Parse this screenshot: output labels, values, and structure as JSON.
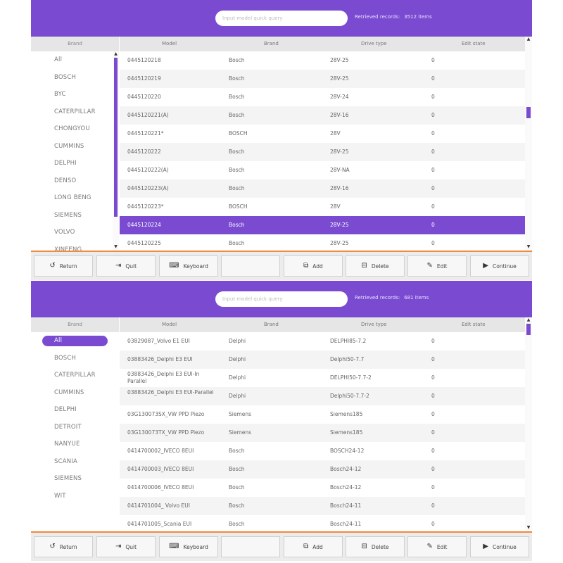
{
  "panels": [
    {
      "search": {
        "placeholder": "Input model quick query"
      },
      "records": {
        "label": "Retrieved records:",
        "value": "3512 items"
      },
      "brand": {
        "header": "Brand",
        "items": [
          "All",
          "BOSCH",
          "BYC",
          "CATERPILLAR",
          "CHONGYOU",
          "CUMMINS",
          "DELPHI",
          "DENSO",
          "LONG BENG",
          "SIEMENS",
          "VOLVO",
          "XINFENG"
        ],
        "selected_index": null,
        "scroll": {
          "up_arrow": "▲",
          "down_arrow": "▼"
        }
      },
      "table": {
        "columns": [
          "Model",
          "Brand",
          "Drive type",
          "Edit state"
        ],
        "rows": [
          [
            "0445120218",
            "Bosch",
            "28V-25",
            "0"
          ],
          [
            "0445120219",
            "Bosch",
            "28V-25",
            "0"
          ],
          [
            "0445120220",
            "Bosch",
            "28V-24",
            "0"
          ],
          [
            "0445120221(A)",
            "Bosch",
            "28V-16",
            "0"
          ],
          [
            "0445120221*",
            "BOSCH",
            "28V",
            "0"
          ],
          [
            "0445120222",
            "Bosch",
            "28V-25",
            "0"
          ],
          [
            "0445120222(A)",
            "Bosch",
            "28V-NA",
            "0"
          ],
          [
            "0445120223(A)",
            "Bosch",
            "28V-16",
            "0"
          ],
          [
            "0445120223*",
            "BOSCH",
            "28V",
            "0"
          ],
          [
            "0445120224",
            "Bosch",
            "28V-25",
            "0"
          ],
          [
            "0445120225",
            "Bosch",
            "28V-25",
            "0"
          ]
        ],
        "selected_row": 9,
        "scroll": {
          "up_arrow": "▲",
          "down_arrow": "▼"
        }
      }
    },
    {
      "search": {
        "placeholder": "Input model quick query"
      },
      "records": {
        "label": "Retrieved records:",
        "value": "681 items"
      },
      "brand": {
        "header": "Brand",
        "items": [
          "All",
          "BOSCH",
          "CATERPILLAR",
          "CUMMINS",
          "DELPHI",
          "DETROIT",
          "NANYUE",
          "SCANIA",
          "SIEMENS",
          "WIT"
        ],
        "selected_index": 0
      },
      "table": {
        "columns": [
          "Model",
          "Brand",
          "Drive type",
          "Edit state"
        ],
        "rows": [
          [
            "03829087_Volvo E1 EUI",
            "Delphi",
            "DELPHI85-7.2",
            "0"
          ],
          [
            "03883426_Delphi E3 EUI",
            "Delphi",
            "Delphi50-7.7",
            "0"
          ],
          [
            "03883426_Delphi E3 EUI-In Parallel",
            "Delphi",
            "DELPHI50-7.7-2",
            "0"
          ],
          [
            "03883426_Delphi E3 EUI-Parallel",
            "Delphi",
            "Delphi50-7.7-2",
            "0"
          ],
          [
            "03G130073SX_VW PPD Piezo",
            "Siemens",
            "Siemens185",
            "0"
          ],
          [
            "03G130073TX_VW PPD Piezo",
            "Siemens",
            "Siemens185",
            "0"
          ],
          [
            "0414700002_IVECO 8EUI",
            "Bosch",
            "BOSCH24-12",
            "0"
          ],
          [
            "0414700003_IVECO 8EUI",
            "Bosch",
            "Bosch24-12",
            "0"
          ],
          [
            "0414700006_IVECO 8EUI",
            "Bosch",
            "Bosch24-12",
            "0"
          ],
          [
            "0414701004_ Volvo EUI",
            "Bosch",
            "Bosch24-11",
            "0"
          ],
          [
            "0414701005_Scania EUI",
            "Bosch",
            "Bosch24-11",
            "0"
          ]
        ],
        "selected_row": null,
        "scroll": {
          "up_arrow": "▲",
          "down_arrow": "▼"
        }
      }
    }
  ],
  "toolbar": {
    "buttons": [
      {
        "label": "Return",
        "icon": "return-icon",
        "glyph": "↺"
      },
      {
        "label": "Quit",
        "icon": "quit-icon",
        "glyph": "⇥"
      },
      {
        "label": "Keyboard",
        "icon": "keyboard-icon",
        "glyph": "⌨"
      },
      {
        "label": "",
        "icon": "",
        "glyph": ""
      },
      {
        "label": "Add",
        "icon": "add-icon",
        "glyph": "⧉"
      },
      {
        "label": "Delete",
        "icon": "trash-icon",
        "glyph": "⊟"
      },
      {
        "label": "Edit",
        "icon": "edit-icon",
        "glyph": "✎"
      },
      {
        "label": "Continue",
        "icon": "play-icon",
        "glyph": "▶"
      }
    ]
  },
  "colors": {
    "accent": "#7a4bd0",
    "divider": "#f08a3c"
  }
}
